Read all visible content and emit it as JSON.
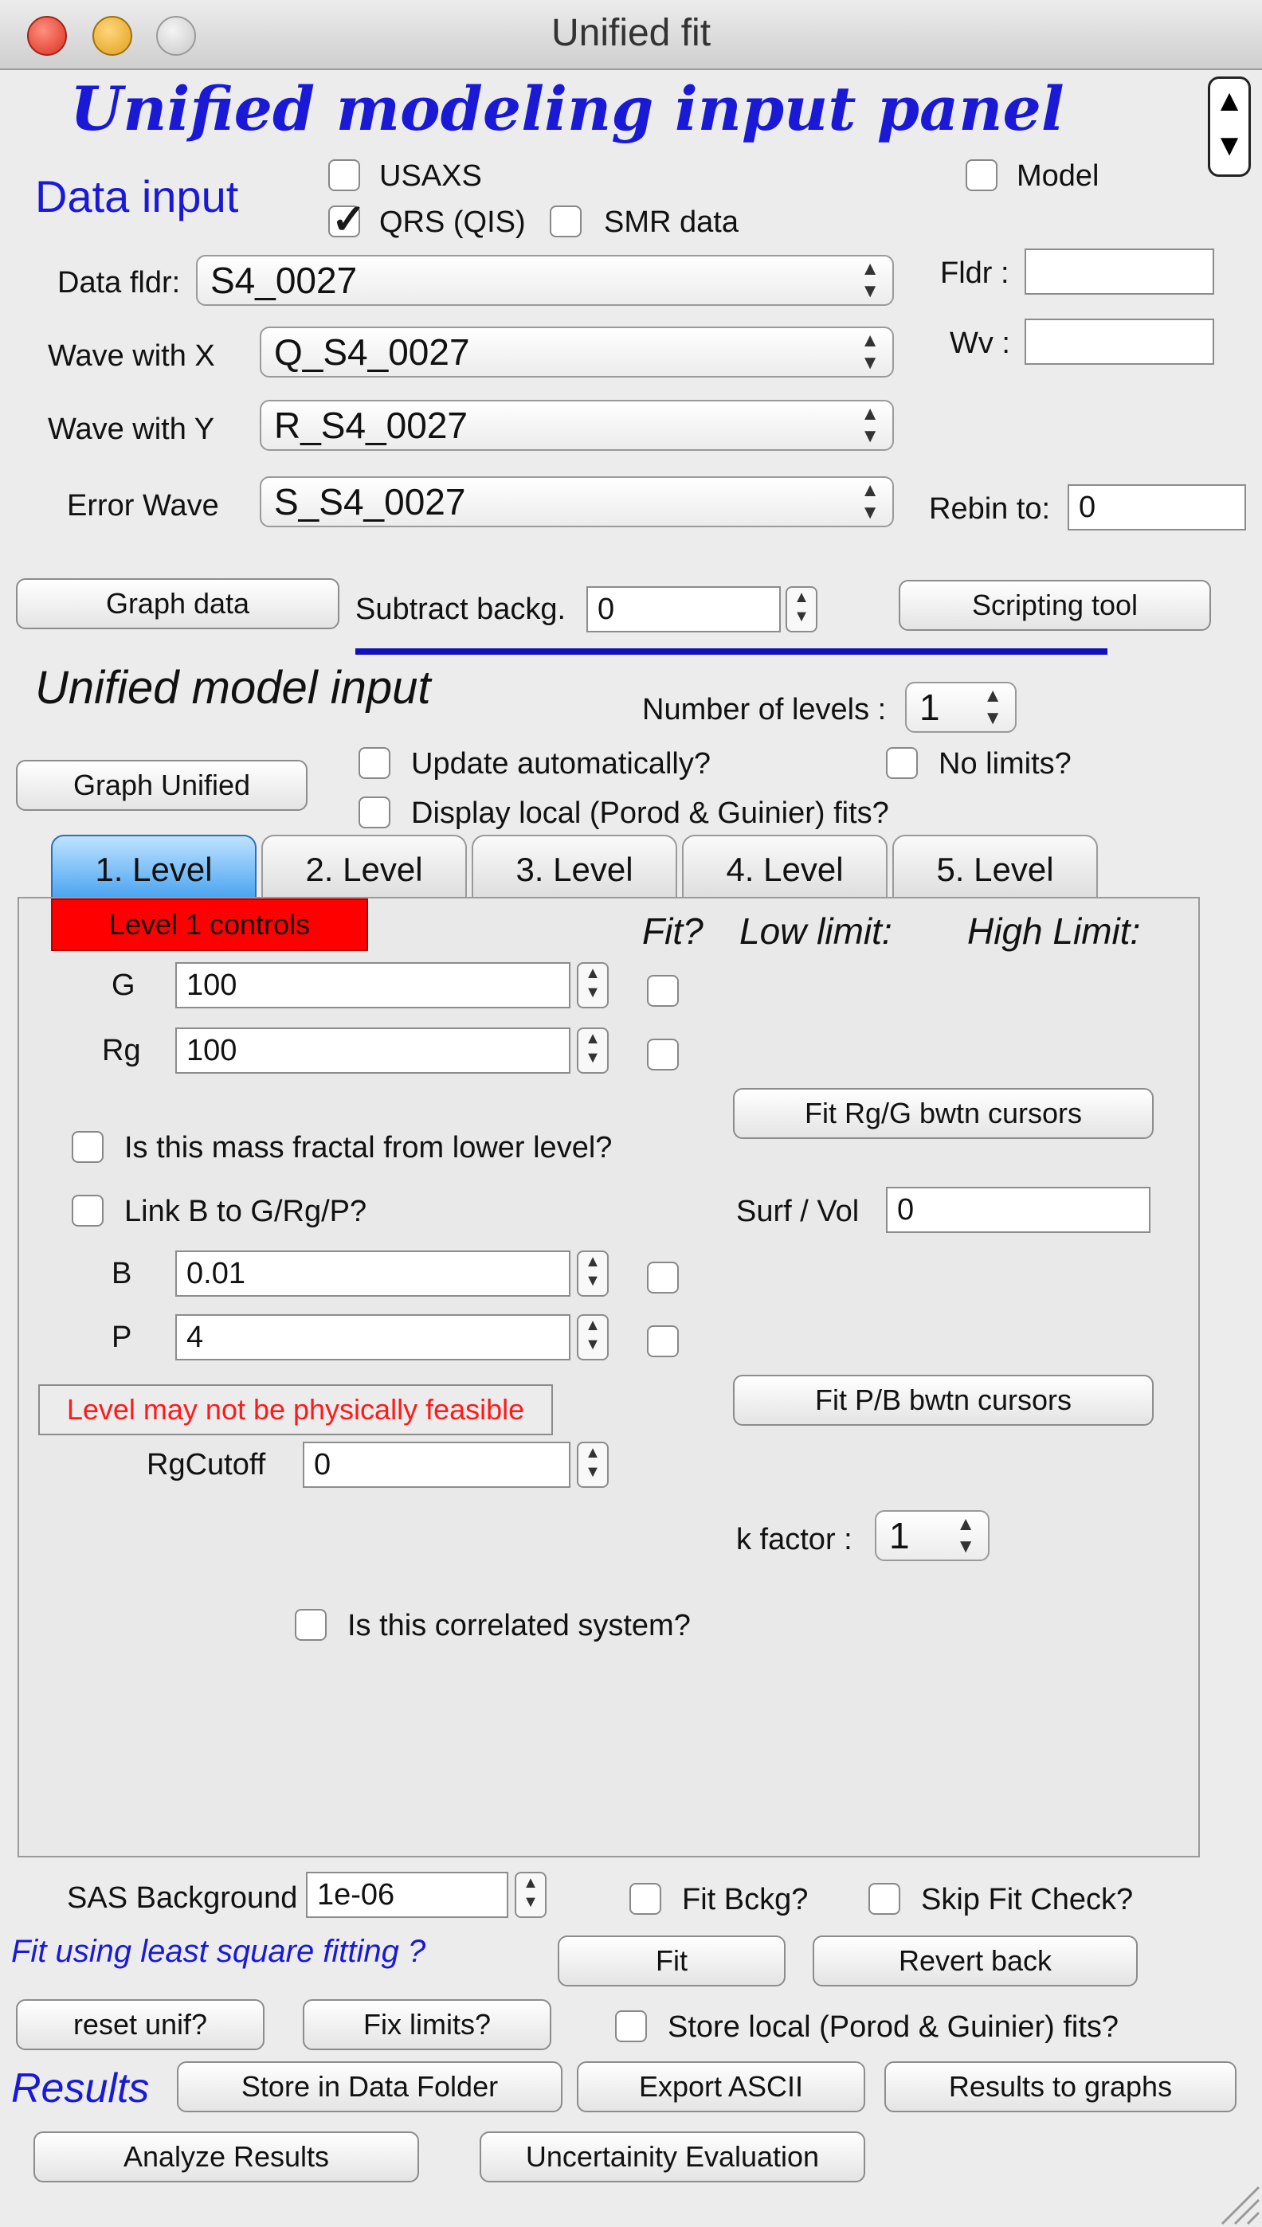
{
  "window": {
    "title": "Unified fit"
  },
  "header": {
    "title": "Unified modeling input panel"
  },
  "data_input": {
    "heading": "Data input",
    "usaxs_label": "USAXS",
    "usaxs_checked": false,
    "qrs_label": "QRS (QIS)",
    "qrs_checked": true,
    "smr_label": "SMR data",
    "smr_checked": false,
    "model_label": "Model",
    "model_checked": false,
    "data_folder_label": "Data fldr:",
    "data_folder_value": "S4_0027",
    "wave_x_label": "Wave with X",
    "wave_x_value": "Q_S4_0027",
    "wave_y_label": "Wave with Y",
    "wave_y_value": "R_S4_0027",
    "error_wave_label": "Error Wave",
    "error_wave_value": "S_S4_0027",
    "fldr_label": "Fldr :",
    "fldr_value": "",
    "wv_label": "Wv :",
    "wv_value": "",
    "rebin_label": "Rebin to:",
    "rebin_value": "0",
    "graph_data_button": "Graph data",
    "subtract_label": "Subtract backg.",
    "subtract_value": "0",
    "scripting_button": "Scripting tool"
  },
  "model_input": {
    "heading": "Unified model input",
    "levels_label": "Number of levels :",
    "levels_value": "1",
    "graph_unified_button": "Graph Unified",
    "update_auto_label": "Update automatically?",
    "no_limits_label": "No limits?",
    "display_local_label": "Display local (Porod & Guinier) fits?"
  },
  "tabs": [
    "1. Level",
    "2. Level",
    "3. Level",
    "4. Level",
    "5. Level"
  ],
  "level": {
    "controls_label": "Level  1 controls",
    "fit_header": "Fit?",
    "low_header": "Low limit:",
    "high_header": "High Limit:",
    "g_label": "G",
    "g_value": "100",
    "rg_label": "Rg",
    "rg_value": "100",
    "fit_rg_g_button": "Fit Rg/G bwtn cursors",
    "mass_fractal_label": "Is this mass fractal from lower level?",
    "link_b_label": "Link B to G/Rg/P?",
    "surf_vol_label": "Surf / Vol",
    "surf_vol_value": "0",
    "b_label": "B",
    "b_value": "0.01",
    "p_label": "P",
    "p_value": "4",
    "warning": "Level may not be physically feasible",
    "fit_p_b_button": "Fit P/B bwtn cursors",
    "rgcutoff_label": "RgCutoff",
    "rgcutoff_value": "0",
    "kfactor_label": "k factor :",
    "kfactor_value": "1",
    "correlated_label": "Is this correlated system?"
  },
  "bottom": {
    "sas_bg_label": "SAS Background",
    "sas_bg_value": "1e-06",
    "fit_bckg_label": "Fit Bckg?",
    "skip_fit_label": "Skip Fit Check?",
    "least_square_label": "Fit using least square fitting ?",
    "fit_button": "Fit",
    "revert_button": "Revert back",
    "reset_button": "reset unif?",
    "fix_limits_button": "Fix limits?",
    "store_local_label": "Store local (Porod & Guinier) fits?",
    "results_label": "Results",
    "store_folder_button": "Store in Data Folder",
    "export_ascii_button": "Export ASCII",
    "results_graphs_button": "Results to graphs",
    "analyze_button": "Analyze Results",
    "uncertainty_button": "Uncertainity Evaluation"
  },
  "colors": {
    "accent_blue": "#1a1ad6",
    "warning_red": "#ff1a1a",
    "level_red": "#ff0000",
    "tab_active": "#4aa3f0"
  }
}
